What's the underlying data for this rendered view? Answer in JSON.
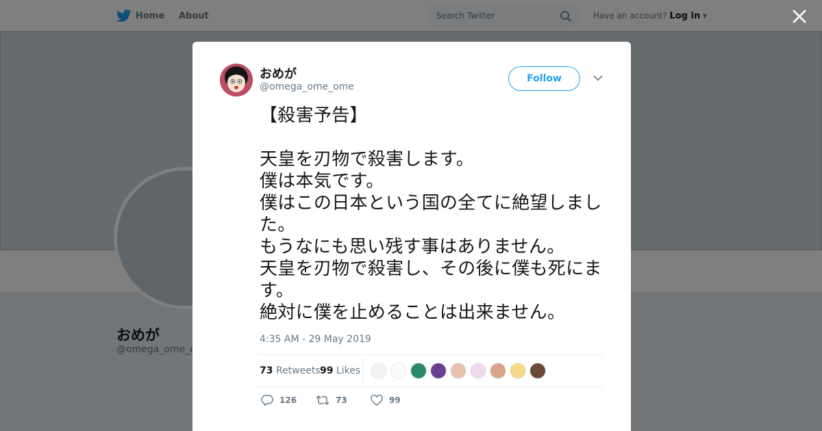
{
  "nav": {
    "home_label": "Home",
    "about_label": "About",
    "search_placeholder": "Search Twitter",
    "account_text": "Have an account?",
    "login_label": "Log in"
  },
  "background_profile": {
    "name": "おめが",
    "handle": "@omega_ome_ome"
  },
  "tweet": {
    "name": "おめが",
    "handle": "@omega_ome_ome",
    "follow_label": "Follow",
    "text": "【殺害予告】\n\n天皇を刃物で殺害します。\n僕は本気です。\n僕はこの日本という国の全てに絶望しました。\nもうなにも思い残す事はありません。\n天皇を刃物で殺害し、その後に僕も死にます。\n絶対に僕を止めることは出来ません。",
    "timestamp": "4:35 AM - 29 May 2019",
    "retweets_count": "73",
    "retweets_label": "Retweets",
    "likes_count": "99",
    "likes_label": "Likes",
    "reply_action_count": "126",
    "retweet_action_count": "73",
    "like_action_count": "99"
  },
  "colors": {
    "accent": "#1da1f2",
    "secondary_text": "#657786",
    "liker_avatars": [
      "#f2f2f2",
      "#fafafa",
      "#2a8a6a",
      "#6b3f91",
      "#e8c0b0",
      "#f0d8f0",
      "#d9a58a",
      "#f5d68a",
      "#6b4a3a"
    ]
  },
  "icons": {
    "brand": "twitter-bird-icon",
    "search": "search-icon",
    "close": "close-icon",
    "caret": "chevron-down-icon",
    "reply": "reply-icon",
    "retweet": "retweet-icon",
    "like": "heart-icon"
  }
}
